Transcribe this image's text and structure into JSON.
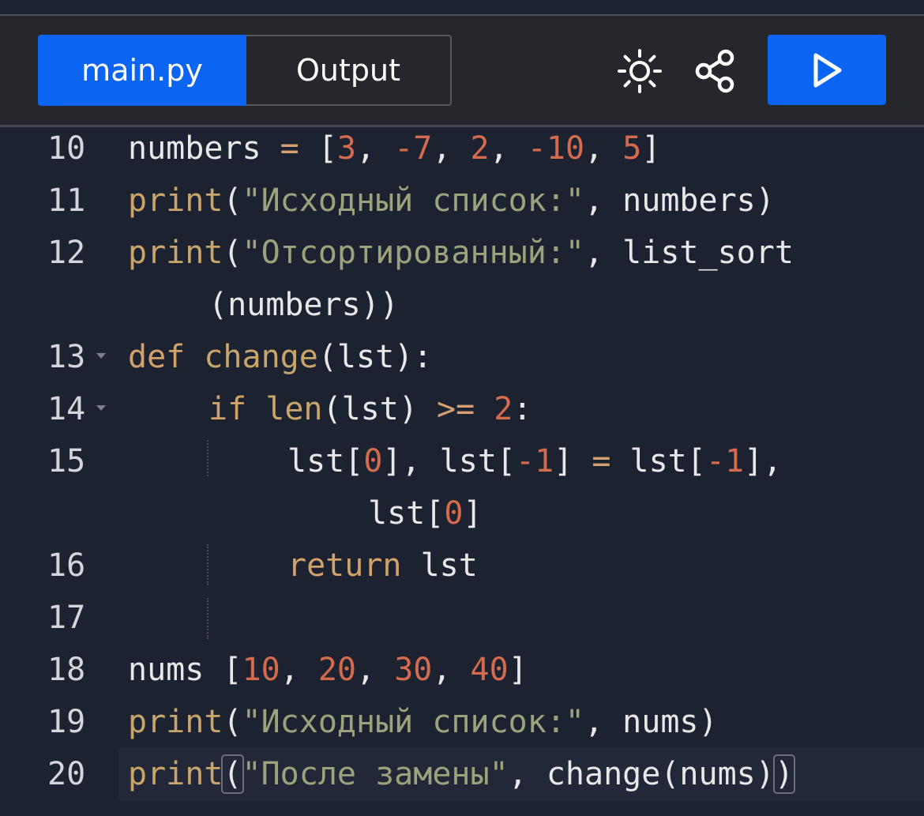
{
  "tabs": [
    {
      "label": "main.py",
      "active": true
    },
    {
      "label": "Output",
      "active": false
    }
  ],
  "toolbar_icons": [
    "theme-sun-icon",
    "share-icon",
    "play-icon"
  ],
  "colors": {
    "accent": "#0c65f2",
    "toolbar_bg": "#25272d",
    "editor_bg": "#1d2231",
    "keyword": "#d1a26a",
    "string": "#9ba27c",
    "number": "#d46b4e",
    "text": "#e8e8e8"
  },
  "lines": [
    {
      "n": "10",
      "tokens": [
        [
          "numbers ",
          "pn"
        ],
        [
          "=",
          "op"
        ],
        [
          " [",
          "br"
        ],
        [
          "3",
          "num"
        ],
        [
          ", ",
          "pn"
        ],
        [
          "-7",
          "num"
        ],
        [
          ", ",
          "pn"
        ],
        [
          "2",
          "num"
        ],
        [
          ", ",
          "pn"
        ],
        [
          "-10",
          "num"
        ],
        [
          ", ",
          "pn"
        ],
        [
          "5",
          "num"
        ],
        [
          "]",
          "br"
        ]
      ]
    },
    {
      "n": "11",
      "tokens": [
        [
          "print",
          "fn"
        ],
        [
          "(",
          "pn"
        ],
        [
          "\"Исходный список:\"",
          "str"
        ],
        [
          ", numbers)",
          "pn"
        ]
      ]
    },
    {
      "n": "12",
      "tokens": [
        [
          "print",
          "fn"
        ],
        [
          "(",
          "pn"
        ],
        [
          "\"Отсортированный:\"",
          "str"
        ],
        [
          ", list_sort",
          "pn"
        ]
      ]
    },
    {
      "n": "",
      "tokens": [
        [
          "(numbers))",
          "pn"
        ]
      ],
      "indent": 1
    },
    {
      "n": "13",
      "fold": true,
      "tokens": [
        [
          "def ",
          "kw"
        ],
        [
          "change",
          "fn"
        ],
        [
          "(lst):",
          "pn"
        ]
      ]
    },
    {
      "n": "14",
      "fold": true,
      "indent": 1,
      "tokens": [
        [
          "if ",
          "kw"
        ],
        [
          "len",
          "fn"
        ],
        [
          "(lst) ",
          "pn"
        ],
        [
          ">=",
          "op"
        ],
        [
          " ",
          "pn"
        ],
        [
          "2",
          "num"
        ],
        [
          ":",
          "pn"
        ]
      ]
    },
    {
      "n": "15",
      "indent": 2,
      "tokens": [
        [
          "lst[",
          "pn"
        ],
        [
          "0",
          "num"
        ],
        [
          "], lst[",
          "pn"
        ],
        [
          "-1",
          "num"
        ],
        [
          "] ",
          "pn"
        ],
        [
          "=",
          "op"
        ],
        [
          " lst[",
          "pn"
        ],
        [
          "-1",
          "num"
        ],
        [
          "],",
          "pn"
        ]
      ]
    },
    {
      "n": "",
      "indent": 3,
      "tokens": [
        [
          "lst[",
          "pn"
        ],
        [
          "0",
          "num"
        ],
        [
          "]",
          "pn"
        ]
      ]
    },
    {
      "n": "16",
      "indent": 2,
      "tokens": [
        [
          "return ",
          "kw"
        ],
        [
          "lst",
          "pn"
        ]
      ]
    },
    {
      "n": "17",
      "tokens": []
    },
    {
      "n": "18",
      "tokens": [
        [
          "nums [",
          "pn"
        ],
        [
          "10",
          "num"
        ],
        [
          ", ",
          "pn"
        ],
        [
          "20",
          "num"
        ],
        [
          ", ",
          "pn"
        ],
        [
          "30",
          "num"
        ],
        [
          ", ",
          "pn"
        ],
        [
          "40",
          "num"
        ],
        [
          "]",
          "pn"
        ]
      ]
    },
    {
      "n": "19",
      "tokens": [
        [
          "print",
          "fn"
        ],
        [
          "(",
          "pn"
        ],
        [
          "\"Исходный список:\"",
          "str"
        ],
        [
          ", nums)",
          "pn"
        ]
      ]
    },
    {
      "n": "20",
      "active": true,
      "tokens": [
        [
          "print",
          "fn"
        ],
        [
          "(",
          "bhl"
        ],
        [
          "\"После замены\"",
          "str"
        ],
        [
          ", change(nums)",
          "pn"
        ],
        [
          ")",
          "bhl"
        ]
      ]
    }
  ]
}
